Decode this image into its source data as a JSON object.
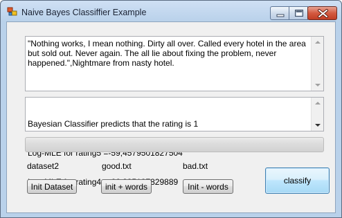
{
  "window": {
    "title": "Naive Bayes Classiffier Example"
  },
  "review_box": {
    "text": "\"Nothing works, I mean nothing. Dirty all over. Called every hotel in the area but sold out. Never again. The all lie about fixing the problem, never happened.\",Nightmare from nasty hotel."
  },
  "output_box": {
    "lines": [
      "Bayesian Classifier predicts that the rating is 1",
      "Log-MLE for rating5 =-59,4579501827504",
      "Log-MLE for rating4 =-66,835187829889"
    ]
  },
  "progress": {
    "fraction": 0.0
  },
  "labels": {
    "dataset": "dataset2",
    "good_file": "good.txt",
    "bad_file": "bad.txt"
  },
  "buttons": {
    "init_dataset": "Init Dataset",
    "init_plus_words": "init + words",
    "init_minus_words": "Init - words",
    "classify": "classify"
  },
  "icons": {
    "app": "app-icon",
    "minimize": "minimize-icon",
    "maximize": "maximize-icon",
    "close": "close-icon"
  },
  "colors": {
    "close_button": "#c13d24",
    "progress_fill": "#06b025",
    "classify_focus": "#3c7fb1"
  }
}
